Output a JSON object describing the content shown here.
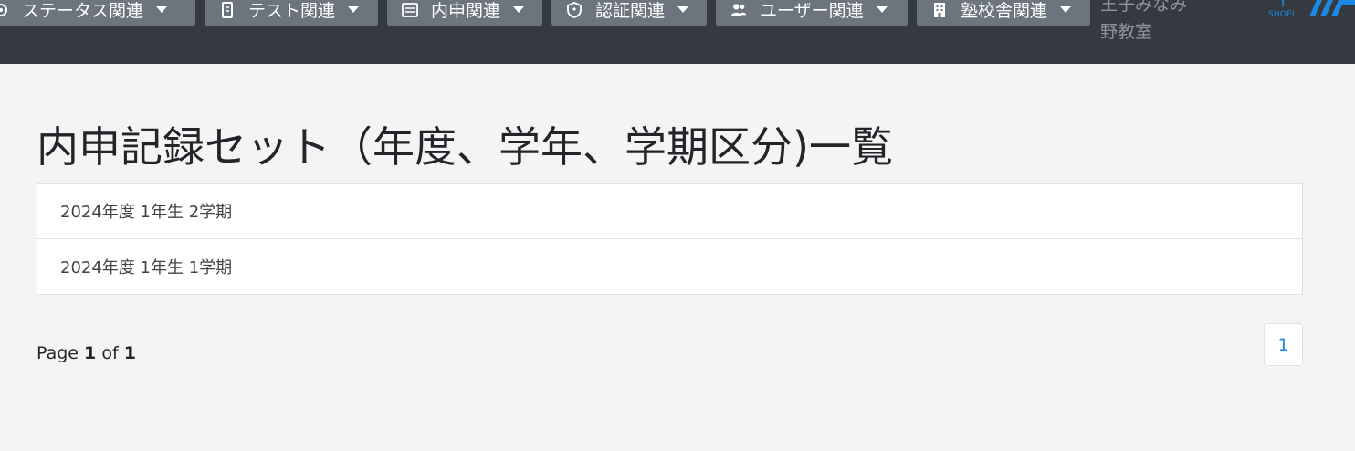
{
  "nav": {
    "menus": [
      {
        "label": "ステータス関連",
        "icon": "gear-icon"
      },
      {
        "label": "テスト関連",
        "icon": "document-icon"
      },
      {
        "label": "内申関連",
        "icon": "list-icon"
      },
      {
        "label": "認証関連",
        "icon": "shield-icon"
      },
      {
        "label": "ユーザー関連",
        "icon": "users-icon"
      },
      {
        "label": "塾校舎関連",
        "icon": "building-icon"
      }
    ],
    "school_name": "王子みなみ野教室",
    "logo_text": "SHOEI"
  },
  "main": {
    "title": "内申記録セット（年度、学年、学期区分)一覧",
    "items": [
      {
        "label": "2024年度 1年生 2学期"
      },
      {
        "label": "2024年度 1年生 1学期"
      }
    ]
  },
  "pagination": {
    "page_word": "Page",
    "current": "1",
    "of_word": "of",
    "total": "1",
    "link": "1"
  },
  "colors": {
    "navbar": "#343a40",
    "nav_button": "#6c757d",
    "link": "#1e88e5"
  }
}
